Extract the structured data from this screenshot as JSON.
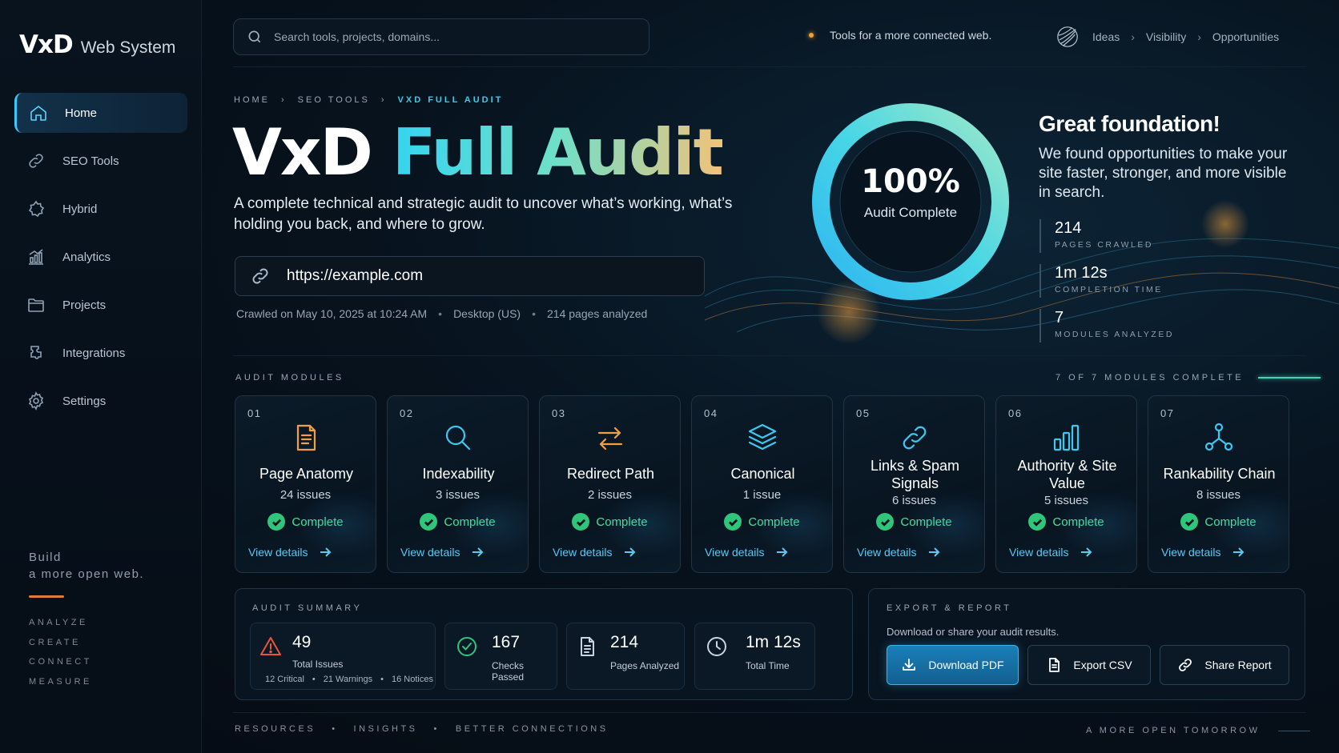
{
  "brand": {
    "mark": "VxD",
    "name": "Web System"
  },
  "sidebar": {
    "items": [
      {
        "label": "Home",
        "icon": "home-icon",
        "active": true
      },
      {
        "label": "SEO Tools",
        "icon": "link-icon"
      },
      {
        "label": "Hybrid",
        "icon": "hybrid-icon"
      },
      {
        "label": "Analytics",
        "icon": "analytics-icon"
      },
      {
        "label": "Projects",
        "icon": "folder-icon"
      },
      {
        "label": "Integrations",
        "icon": "integrations-icon"
      },
      {
        "label": "Settings",
        "icon": "gear-icon"
      }
    ],
    "tagline_line1": "Build",
    "tagline_line2": "a more open web.",
    "tag_list": [
      "ANALYZE",
      "CREATE",
      "CONNECT",
      "MEASURE"
    ]
  },
  "search": {
    "placeholder": "Search tools, projects, domains..."
  },
  "topbar": {
    "tagline": "Tools for a more connected web.",
    "crumbs": [
      "Ideas",
      "Visibility",
      "Opportunities"
    ],
    "sep": "›"
  },
  "breadcrumb": {
    "home": "HOME",
    "tools": "SEO TOOLS",
    "current": "VXD FULL AUDIT",
    "sep": "›"
  },
  "hero": {
    "title_white": "VxD",
    "title_gradient": "Full Audit",
    "subtitle": "A complete technical and strategic audit to uncover what’s working, what’s holding you back, and where to grow.",
    "url": "https://example.com",
    "crawled": "Crawled on May 10, 2025 at 10:24 AM",
    "device": "Desktop (US)",
    "pages": "214 pages analyzed",
    "bullet": "•"
  },
  "ring": {
    "percent": "100%",
    "label": "Audit Complete",
    "progress": 1.0
  },
  "foundation": {
    "title": "Great foundation!",
    "text": "We found opportunities to make your site faster, stronger, and more visible in search.",
    "stats": [
      {
        "value": "214",
        "label": "PAGES CRAWLED"
      },
      {
        "value": "1m 12s",
        "label": "COMPLETION TIME"
      },
      {
        "value": "7",
        "label": "MODULES ANALYZED"
      }
    ]
  },
  "modules_section": {
    "label": "AUDIT MODULES",
    "progress_text": "7 OF 7 MODULES COMPLETE"
  },
  "modules": [
    {
      "num": "01",
      "name": "Page Anatomy",
      "issues": "24 issues",
      "status": "Complete",
      "link": "View details",
      "icon": "document-icon",
      "color": "#f0a040",
      "two_line": false
    },
    {
      "num": "02",
      "name": "Indexability",
      "issues": "3 issues",
      "status": "Complete",
      "link": "View details",
      "icon": "search-icon",
      "color": "#3cc8f0",
      "two_line": false
    },
    {
      "num": "03",
      "name": "Redirect Path",
      "issues": "2 issues",
      "status": "Complete",
      "link": "View details",
      "icon": "redirect-icon",
      "color": "#f0a040",
      "two_line": false
    },
    {
      "num": "04",
      "name": "Canonical",
      "issues": "1 issue",
      "status": "Complete",
      "link": "View details",
      "icon": "layers-icon",
      "color": "#3cc8f0",
      "two_line": false
    },
    {
      "num": "05",
      "name": "Links & Spam Signals",
      "issues": "6 issues",
      "status": "Complete",
      "link": "View details",
      "icon": "link-icon",
      "color": "#3cc8f0",
      "two_line": true
    },
    {
      "num": "06",
      "name": "Authority & Site Value",
      "issues": "5 issues",
      "status": "Complete",
      "link": "View details",
      "icon": "bar-chart-icon",
      "color": "#3cc8f0",
      "two_line": true
    },
    {
      "num": "07",
      "name": "Rankability Chain",
      "issues": "8 issues",
      "status": "Complete",
      "link": "View details",
      "icon": "network-icon",
      "color": "#3cc8f0",
      "two_line": false
    }
  ],
  "summary": {
    "label": "AUDIT SUMMARY",
    "total_issues": {
      "value": "49",
      "label": "Total Issues"
    },
    "breakdown": [
      "12 Critical",
      "21 Warnings",
      "16 Notices"
    ],
    "checks": {
      "value": "167",
      "label": "Checks Passed"
    },
    "pages": {
      "value": "214",
      "label": "Pages Analyzed"
    },
    "time": {
      "value": "1m 12s",
      "label": "Total Time"
    }
  },
  "export": {
    "label": "EXPORT & REPORT",
    "desc": "Download or share your audit results.",
    "pdf": "Download PDF",
    "csv": "Export CSV",
    "share": "Share Report"
  },
  "footer": {
    "left": [
      "RESOURCES",
      "INSIGHTS",
      "BETTER CONNECTIONS"
    ],
    "right": "A MORE OPEN TOMORROW"
  },
  "colors": {
    "accent": "#3cc8ff",
    "success": "#2fc67c",
    "warning": "#f0a040",
    "critical": "#e8553a"
  }
}
